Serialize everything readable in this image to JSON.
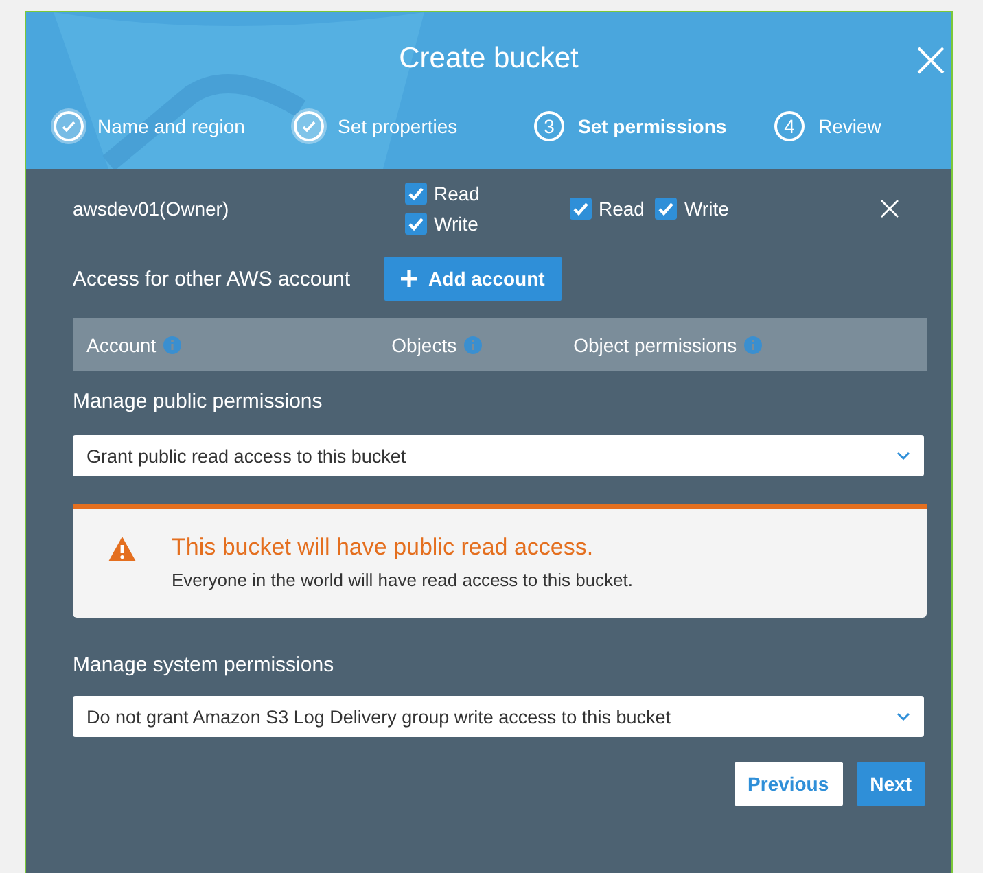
{
  "dialog": {
    "title": "Create bucket"
  },
  "steps": [
    {
      "label": "Name and region",
      "completed": true,
      "selected": false
    },
    {
      "label": "Set properties",
      "completed": true,
      "selected": false
    },
    {
      "number": "3",
      "label": "Set permissions",
      "completed": false,
      "selected": true
    },
    {
      "number": "4",
      "label": "Review",
      "completed": false,
      "selected": false
    }
  ],
  "owner_row": {
    "account": "awsdev01(Owner)",
    "objects": [
      {
        "label": "Read",
        "checked": true
      },
      {
        "label": "Write",
        "checked": true
      }
    ],
    "object_permissions": [
      {
        "label": "Read",
        "checked": true
      },
      {
        "label": "Write",
        "checked": true
      }
    ]
  },
  "other_accounts": {
    "label": "Access for other AWS account",
    "button": "Add account",
    "columns": [
      "Account",
      "Objects",
      "Object permissions"
    ]
  },
  "public_permissions": {
    "label": "Manage public permissions",
    "value": "Grant public read access to this bucket",
    "alert": {
      "title": "This bucket will have public read access.",
      "message": "Everyone in the world will have read access to this bucket."
    }
  },
  "system_permissions": {
    "label": "Manage system permissions",
    "value": "Do not grant Amazon S3 Log Delivery group write access to this bucket"
  },
  "buttons": [
    {
      "label": "Previous",
      "kind": "secondary"
    },
    {
      "label": "Next",
      "kind": "primary"
    }
  ]
}
